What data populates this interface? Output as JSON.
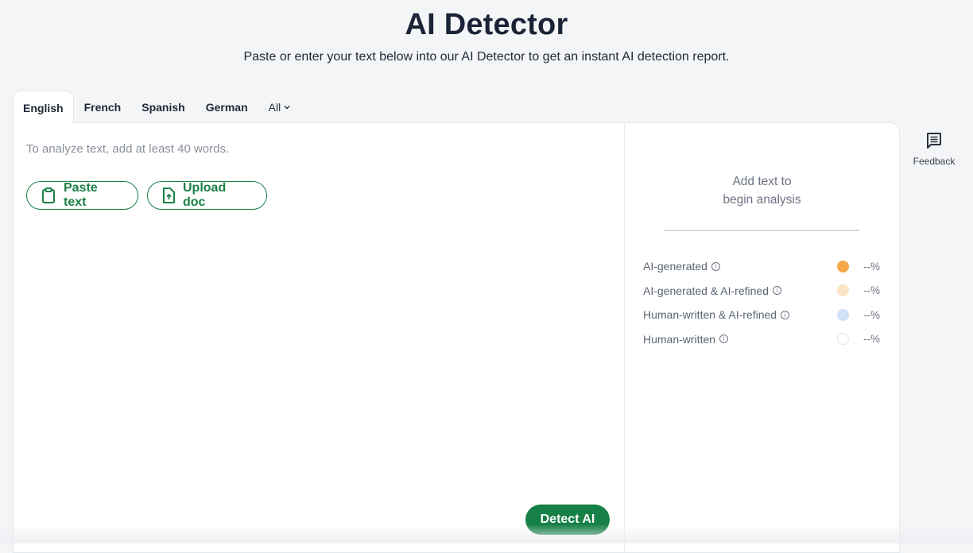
{
  "header": {
    "title": "AI Detector",
    "subtitle": "Paste or enter your text below into our AI Detector to get an instant AI detection report."
  },
  "tabs": [
    {
      "label": "English",
      "active": true
    },
    {
      "label": "French"
    },
    {
      "label": "Spanish"
    },
    {
      "label": "German"
    },
    {
      "label": "All",
      "icon": "chevron-down-icon"
    }
  ],
  "editor": {
    "placeholder": "To analyze text, add at least 40 words.",
    "paste_label": "Paste text",
    "upload_label": "Upload doc",
    "detect_label": "Detect AI"
  },
  "analysis": {
    "line1": "Add text to",
    "line2": "begin analysis",
    "legend": [
      {
        "label": "AI-generated",
        "color": "#f5a94a",
        "value": "--%"
      },
      {
        "label": "AI-generated & AI-refined",
        "color": "#fce3c6",
        "value": "--%"
      },
      {
        "label": "Human-written & AI-refined",
        "color": "#cfe2f8",
        "value": "--%"
      },
      {
        "label": "Human-written",
        "color": "#ffffff",
        "value": "--%"
      }
    ]
  },
  "feedback": {
    "label": "Feedback"
  },
  "colors": {
    "brand_green": "#178046",
    "background": "#f4f5f7"
  }
}
